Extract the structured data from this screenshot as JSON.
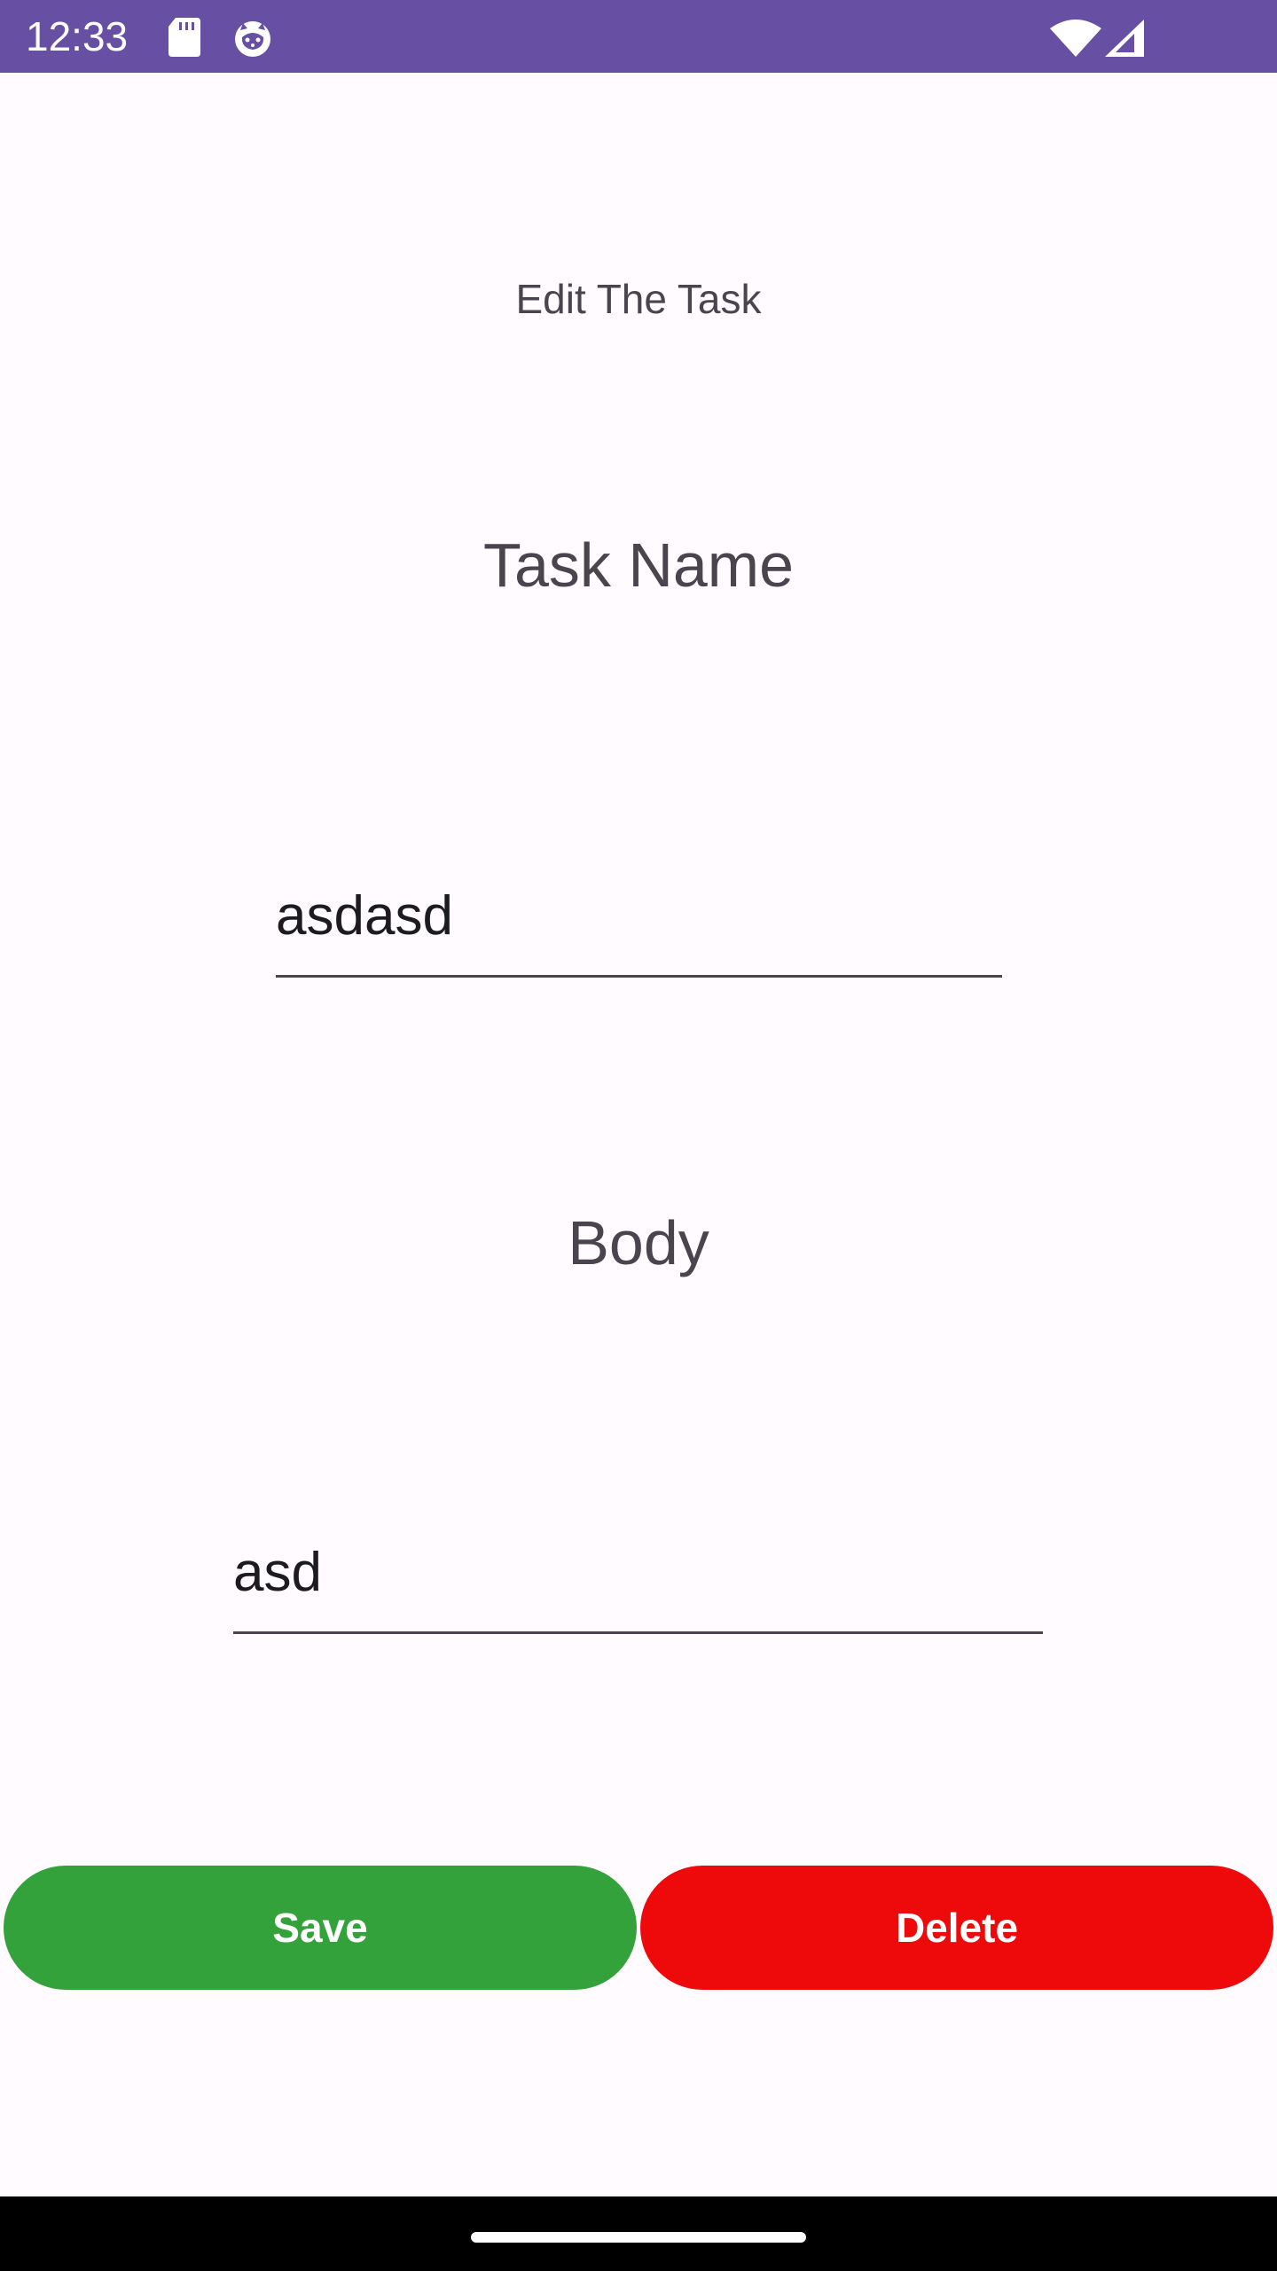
{
  "status_bar": {
    "time": "12:33",
    "icons": [
      "sd-card-icon",
      "cat-face-icon",
      "wifi-icon",
      "cell-signal-icon"
    ],
    "background": "#6750A4"
  },
  "screen": {
    "title": "Edit The Task",
    "background": "#FFFBFE"
  },
  "task_name": {
    "label": "Task Name",
    "value": "asdasd"
  },
  "body": {
    "label": "Body",
    "value": "asd"
  },
  "actions": {
    "save_label": "Save",
    "save_color": "#34A23A",
    "delete_label": "Delete",
    "delete_color": "#EE0A0A"
  },
  "navigation_bar": {
    "style": "gesture",
    "background": "#000000"
  }
}
